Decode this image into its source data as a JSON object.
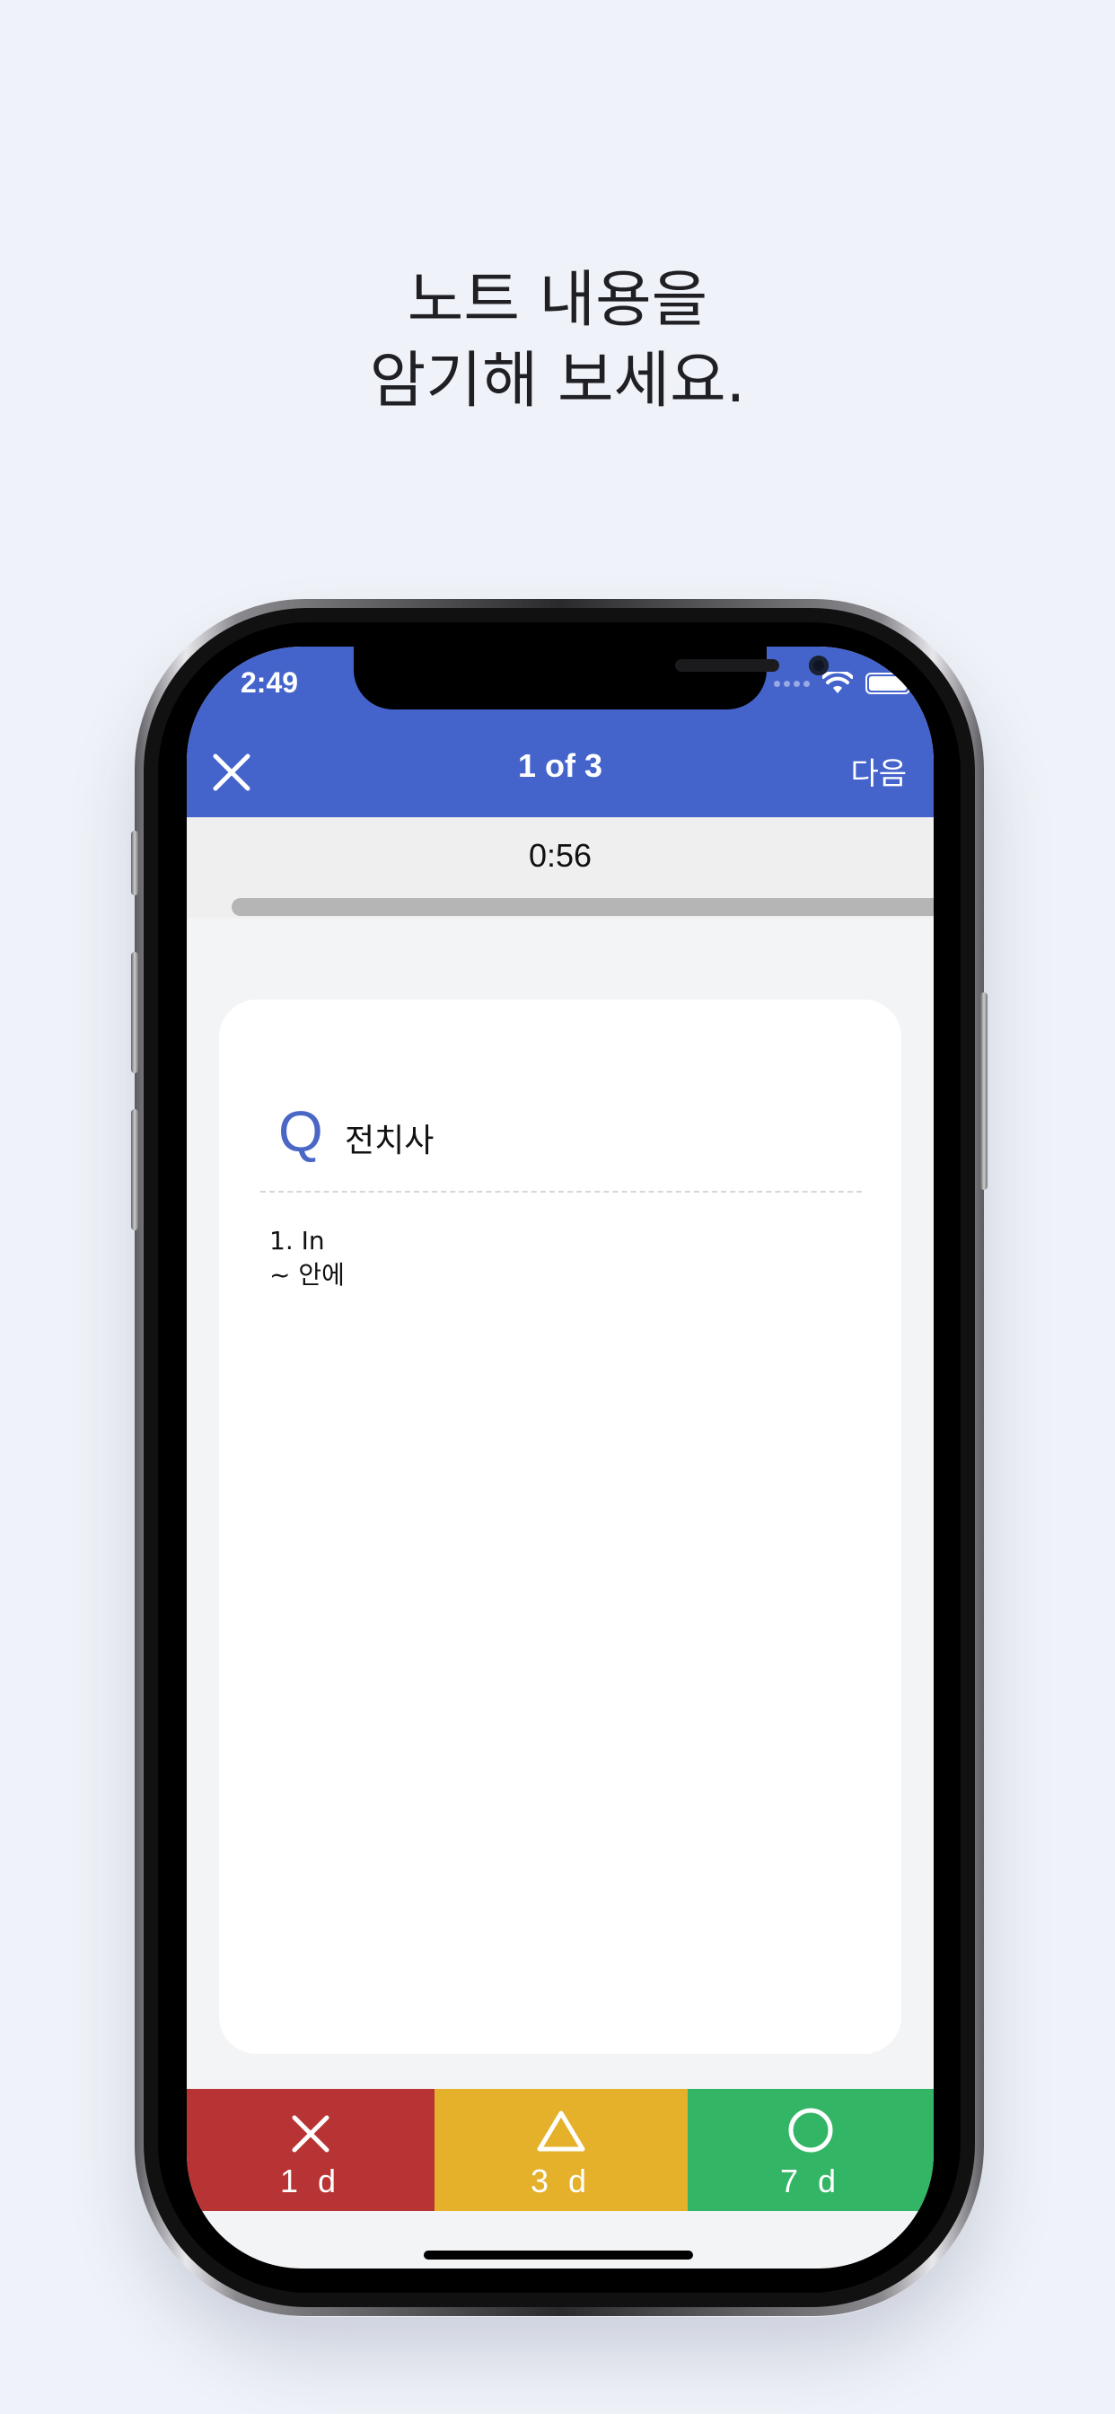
{
  "headline": {
    "line1": "노트 내용을",
    "line2": "암기해 보세요."
  },
  "status_bar": {
    "time": "2:49",
    "icons": [
      "signal-icon",
      "wifi-icon",
      "battery-icon"
    ]
  },
  "nav": {
    "close_icon": "close-icon",
    "title": "1 of 3",
    "next_label": "다음"
  },
  "timer": {
    "text": "0:56",
    "progress": 1.0
  },
  "card": {
    "question_marker": "Q",
    "question": "전치사",
    "answer_lines": [
      "1. In",
      "~ 안에"
    ]
  },
  "rating": [
    {
      "icon": "x-icon",
      "label": "1 d",
      "color": "#b83333"
    },
    {
      "icon": "triangle-icon",
      "label": "3 d",
      "color": "#e5b02a"
    },
    {
      "icon": "circle-icon",
      "label": "7 d",
      "color": "#33b566"
    }
  ],
  "colors": {
    "nav_bar": "#4464cc",
    "background": "#eff2f8",
    "question_marker": "#4a67c6"
  }
}
